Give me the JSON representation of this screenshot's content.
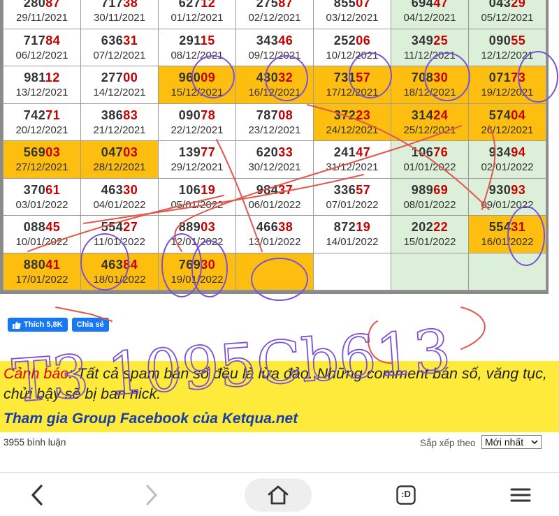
{
  "results": [
    {
      "n": "28087",
      "hi": "87",
      "date": "29/11/2021",
      "bg": "white"
    },
    {
      "n": "71738",
      "hi": "38",
      "date": "30/11/2021",
      "bg": "white"
    },
    {
      "n": "62712",
      "hi": "12",
      "date": "01/12/2021",
      "bg": "white"
    },
    {
      "n": "27587",
      "hi": "87",
      "date": "02/12/2021",
      "bg": "white"
    },
    {
      "n": "85507",
      "hi": "07",
      "date": "03/12/2021",
      "bg": "white"
    },
    {
      "n": "69447",
      "hi": "47",
      "date": "04/12/2021",
      "bg": "green"
    },
    {
      "n": "04329",
      "hi": "29",
      "date": "05/12/2021",
      "bg": "green"
    },
    {
      "n": "71784",
      "hi": "84",
      "date": "06/12/2021",
      "bg": "white"
    },
    {
      "n": "63631",
      "hi": "31",
      "date": "07/12/2021",
      "bg": "white"
    },
    {
      "n": "29115",
      "hi": "15",
      "date": "08/12/2021",
      "bg": "white"
    },
    {
      "n": "34346",
      "hi": "46",
      "date": "09/12/2021",
      "bg": "white"
    },
    {
      "n": "25206",
      "hi": "06",
      "date": "10/12/2021",
      "bg": "white"
    },
    {
      "n": "34925",
      "hi": "25",
      "date": "11/12/2021",
      "bg": "green"
    },
    {
      "n": "09055",
      "hi": "55",
      "date": "12/12/2021",
      "bg": "green"
    },
    {
      "n": "98112",
      "hi": "12",
      "date": "13/12/2021",
      "bg": "white"
    },
    {
      "n": "27700",
      "hi": "00",
      "date": "14/12/2021",
      "bg": "white"
    },
    {
      "n": "96009",
      "hi": "09",
      "date": "15/12/2021",
      "bg": "gold"
    },
    {
      "n": "43032",
      "hi": "32",
      "date": "16/12/2021",
      "bg": "gold"
    },
    {
      "n": "73157",
      "hi": "57",
      "date": "17/12/2021",
      "bg": "gold"
    },
    {
      "n": "70830",
      "hi": "30",
      "date": "18/12/2021",
      "bg": "gold"
    },
    {
      "n": "07173",
      "hi": "73",
      "date": "19/12/2021",
      "bg": "gold"
    },
    {
      "n": "74271",
      "hi": "71",
      "date": "20/12/2021",
      "bg": "white"
    },
    {
      "n": "38683",
      "hi": "83",
      "date": "21/12/2021",
      "bg": "white"
    },
    {
      "n": "09078",
      "hi": "78",
      "date": "22/12/2021",
      "bg": "white"
    },
    {
      "n": "78708",
      "hi": "08",
      "date": "23/12/2021",
      "bg": "white"
    },
    {
      "n": "37223",
      "hi": "23",
      "date": "24/12/2021",
      "bg": "gold"
    },
    {
      "n": "31424",
      "hi": "24",
      "date": "25/12/2021",
      "bg": "gold"
    },
    {
      "n": "57404",
      "hi": "04",
      "date": "26/12/2021",
      "bg": "gold"
    },
    {
      "n": "56903",
      "hi": "03",
      "date": "27/12/2021",
      "bg": "gold"
    },
    {
      "n": "04703",
      "hi": "03",
      "date": "28/12/2021",
      "bg": "gold"
    },
    {
      "n": "13977",
      "hi": "77",
      "date": "29/12/2021",
      "bg": "white"
    },
    {
      "n": "62033",
      "hi": "33",
      "date": "30/12/2021",
      "bg": "white"
    },
    {
      "n": "24147",
      "hi": "47",
      "date": "31/12/2021",
      "bg": "white"
    },
    {
      "n": "10676",
      "hi": "76",
      "date": "01/01/2022",
      "bg": "green"
    },
    {
      "n": "93494",
      "hi": "94",
      "date": "02/01/2022",
      "bg": "green"
    },
    {
      "n": "37061",
      "hi": "61",
      "date": "03/01/2022",
      "bg": "white"
    },
    {
      "n": "46330",
      "hi": "30",
      "date": "04/01/2022",
      "bg": "white"
    },
    {
      "n": "10619",
      "hi": "19",
      "date": "05/01/2022",
      "bg": "white"
    },
    {
      "n": "98437",
      "hi": "37",
      "date": "06/01/2022",
      "bg": "white"
    },
    {
      "n": "33657",
      "hi": "57",
      "date": "07/01/2022",
      "bg": "white"
    },
    {
      "n": "98969",
      "hi": "69",
      "date": "08/01/2022",
      "bg": "green"
    },
    {
      "n": "93093",
      "hi": "93",
      "date": "09/01/2022",
      "bg": "green"
    },
    {
      "n": "08845",
      "hi": "45",
      "date": "10/01/2022",
      "bg": "white"
    },
    {
      "n": "55427",
      "hi": "27",
      "date": "11/01/2022",
      "bg": "white"
    },
    {
      "n": "88903",
      "hi": "03",
      "date": "12/01/2022",
      "bg": "white"
    },
    {
      "n": "46638",
      "hi": "38",
      "date": "13/01/2022",
      "bg": "white"
    },
    {
      "n": "87219",
      "hi": "19",
      "date": "14/01/2022",
      "bg": "white"
    },
    {
      "n": "20222",
      "hi": "22",
      "date": "15/01/2022",
      "bg": "green"
    },
    {
      "n": "55431",
      "hi": "31",
      "date": "16/01/2022",
      "bg": "gold"
    },
    {
      "n": "88041",
      "hi": "41",
      "date": "17/01/2022",
      "bg": "gold"
    },
    {
      "n": "46384",
      "hi": "84",
      "date": "18/01/2022",
      "bg": "gold"
    },
    {
      "n": "76930",
      "hi": "30",
      "date": "19/01/2022",
      "bg": "gold"
    },
    {
      "n": "",
      "hi": "",
      "date": "",
      "bg": "gold"
    },
    {
      "n": "",
      "hi": "",
      "date": "",
      "bg": "white"
    },
    {
      "n": "",
      "hi": "",
      "date": "",
      "bg": "green"
    },
    {
      "n": "",
      "hi": "",
      "date": "",
      "bg": "green"
    }
  ],
  "colors": {
    "gold": "#fdbe10",
    "green_col": "#dcefd9",
    "number_highlight": "#c40000",
    "warning_bg": "#fdea3a",
    "warning_label": "#e00000",
    "group_link": "#1a3ea8",
    "facebook": "#1877f2",
    "scribble_red": "#e2574c",
    "scribble_purple": "#7a52d6"
  },
  "social": {
    "like_icon": "thumbs-up-icon",
    "like_label": "Thích 5,8K",
    "share_label": "Chia sẻ"
  },
  "warning": {
    "label": "Cảnh báo",
    "text": ": Tất cả spam bán số đều là lừa đảo. Những comment bán số, văng tục, chửi bậy sẽ bị ban nick.",
    "group_link": "Tham gia Group Facebook của Ketqua.net"
  },
  "comments": {
    "count_text": "3955 bình luận",
    "sort_label": "Sắp xếp theo",
    "sort_selected": "Mới nhất"
  },
  "browser_nav": {
    "back_icon": "back-arrow-icon",
    "forward_icon": "forward-arrow-icon",
    "home_icon": "home-icon",
    "tabs_label": ":D",
    "menu_icon": "hamburger-menu-icon"
  },
  "handwriting": {
    "color": "#7a52d6",
    "text": "T3 1095Cb613"
  }
}
